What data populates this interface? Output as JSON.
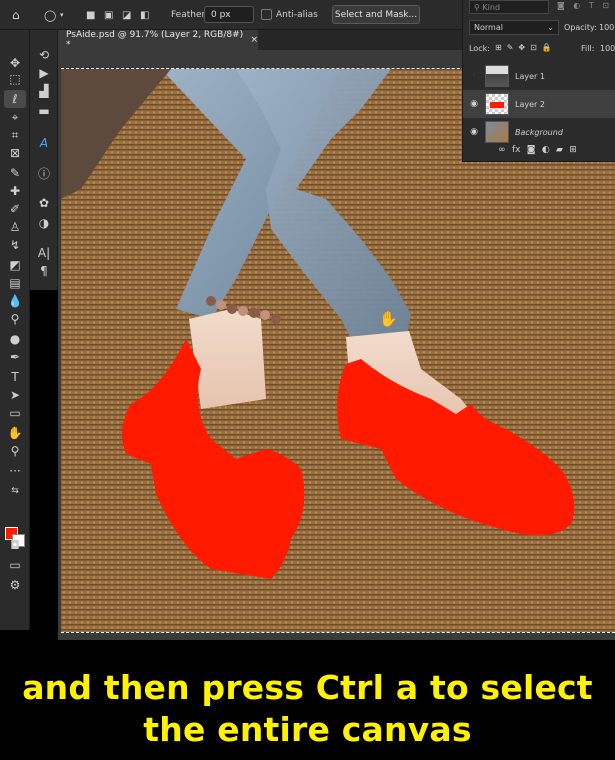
{
  "options_bar": {
    "feather_label": "Feather:",
    "feather_value": "0 px",
    "anti_alias_label": "Anti-alias",
    "select_mask_label": "Select and Mask..."
  },
  "document_tab": {
    "title": "PsAide.psd @ 91.7% (Layer 2, RGB/8#) *",
    "close": "×"
  },
  "layers_panel": {
    "kind_placeholder": "Kind",
    "blend_mode": "Normal",
    "opacity_label": "Opacity:",
    "opacity_value": "100",
    "lock_label": "Lock:",
    "fill_label": "Fill:",
    "fill_value": "100",
    "layers": [
      {
        "name": "Layer 1",
        "visible": false
      },
      {
        "name": "Layer 2",
        "visible": true,
        "selected": true
      },
      {
        "name": "Background",
        "visible": true
      }
    ]
  },
  "colors": {
    "foreground": "#ff1a00",
    "background": "#ffffff",
    "caption": "#fff200"
  },
  "caption": {
    "line1": "and then press Ctrl a to select",
    "line2": "the entire canvas"
  }
}
